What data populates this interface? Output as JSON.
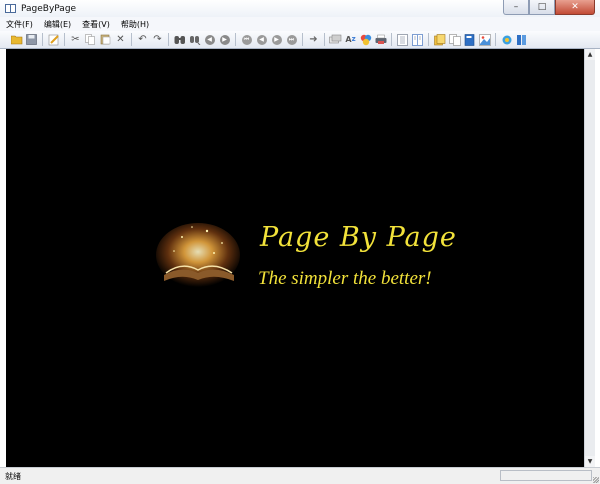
{
  "window": {
    "title": "PageByPage"
  },
  "menu": [
    {
      "label": "文件(F)"
    },
    {
      "label": "编辑(E)"
    },
    {
      "label": "查看(V)"
    },
    {
      "label": "帮助(H)"
    }
  ],
  "toolbar_icons": {
    "group1": [
      "open-folder-icon",
      "save-icon"
    ],
    "group2": [
      "edit-pencil-icon"
    ],
    "group3": [
      "cut-icon",
      "copy-icon",
      "paste-icon",
      "delete-icon"
    ],
    "group4": [
      "undo-icon",
      "redo-icon"
    ],
    "group5": [
      "find-icon",
      "replace-icon",
      "go-back-icon",
      "go-forward-icon"
    ],
    "group6": [
      "first-page-icon",
      "previous-page-icon",
      "play-icon",
      "last-page-icon",
      "goto-icon"
    ],
    "group7": [
      "zoom-out-icon",
      "zoom-in-icon",
      "color-icon",
      "print-icon"
    ],
    "group8": [
      "single-page-icon",
      "two-page-icon"
    ],
    "group9": [
      "bookmark-icon",
      "thumbnails-icon",
      "book-icon",
      "image-icon",
      "settings-icon",
      "library-icon"
    ]
  },
  "canvas": {
    "logo_title": "Page By Page",
    "logo_slogan": "The simpler the better!",
    "text_color": "#f2e23a",
    "background": "#000000"
  },
  "status": {
    "text": "就绪"
  }
}
